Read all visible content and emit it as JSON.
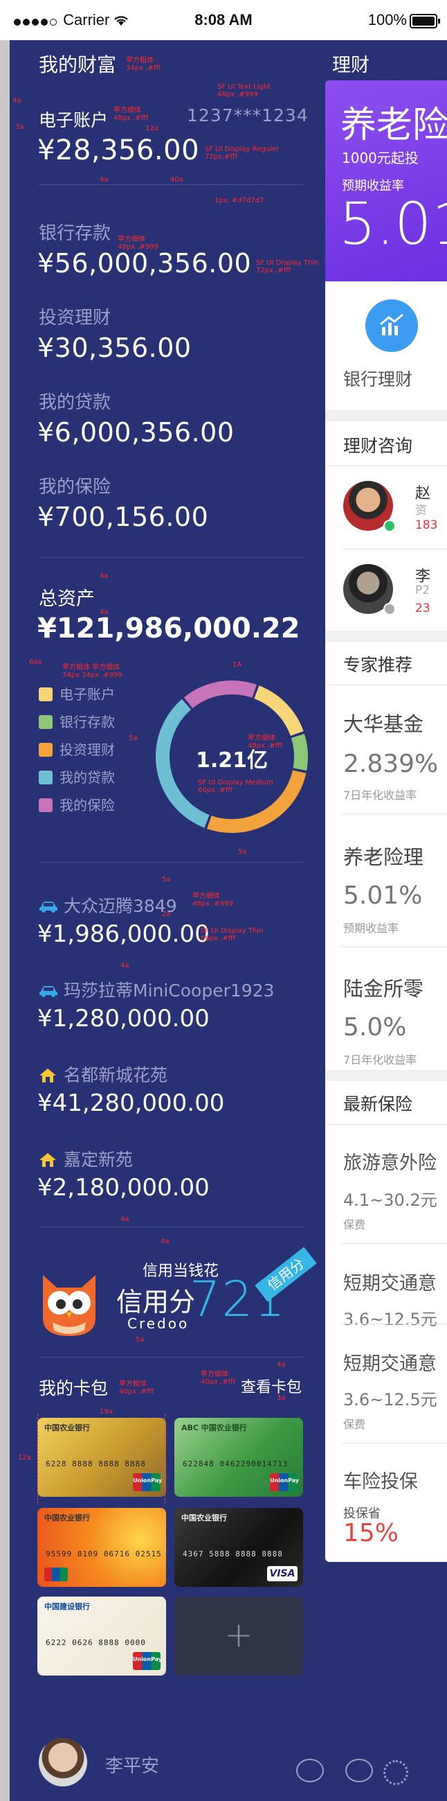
{
  "status_bar": {
    "carrier": "Carrier",
    "time": "8:08 AM",
    "battery": "100%"
  },
  "wealth": {
    "title": "我的财富",
    "e_account_label": "电子账户",
    "e_account_number": "1237***1234",
    "e_account_amount": "¥28,356.00",
    "items": [
      {
        "label": "银行存款",
        "amount": "¥56,000,356.00"
      },
      {
        "label": "投资理财",
        "amount": "¥30,356.00"
      },
      {
        "label": "我的贷款",
        "amount": "¥6,000,356.00"
      },
      {
        "label": "我的保险",
        "amount": "¥700,156.00"
      }
    ],
    "total_label": "总资产",
    "total_amount": "¥121,986,000.22"
  },
  "chart_data": {
    "type": "pie",
    "center_label": "1.21亿",
    "categories": [
      "电子账户",
      "银行存款",
      "投资理财",
      "我的贷款",
      "我的保险"
    ],
    "values": [
      12,
      7,
      23,
      28,
      14
    ],
    "colors": [
      "#f6d678",
      "#8cc677",
      "#f2a33c",
      "#6fbfd2",
      "#c774b8"
    ]
  },
  "assets": [
    {
      "icon": "car-icon",
      "label": "大众迈腾3849",
      "amount": "¥1,986,000.00"
    },
    {
      "icon": "car-icon",
      "label": "玛莎拉蒂MiniCooper1923",
      "amount": "¥1,280,000.00"
    },
    {
      "icon": "house-icon",
      "label": "名都新城花苑",
      "amount": "¥41,280,000.00"
    },
    {
      "icon": "house-icon",
      "label": "嘉定新苑",
      "amount": "¥2,180,000.00"
    }
  ],
  "credit": {
    "slogan": "信用当钱花",
    "label": "信用分",
    "brand": "Credoo",
    "score": "721",
    "ribbon": "信用分"
  },
  "cards": {
    "title": "我的卡包",
    "view_link": "查看卡包",
    "list": [
      {
        "bank": "中国农业银行",
        "number": "6228 8888 8888 8888",
        "style": "gold"
      },
      {
        "bank": "ABC 中国农业银行",
        "number": "622848 0462290014713",
        "style": "green"
      },
      {
        "bank": "中国农业银行",
        "number": "95599 8109 06716 02515",
        "style": "orange"
      },
      {
        "bank": "中国农业银行",
        "number": "4367 5888 8888 8888",
        "style": "black"
      },
      {
        "bank": "中国建设银行",
        "number": "6222 0626 8888 0000",
        "style": "white"
      }
    ],
    "add_symbol": "+"
  },
  "user": {
    "name": "李平安"
  },
  "annotations": {
    "a48": "48a",
    "a4": "4a",
    "a3": "3a",
    "a2": "2a",
    "a12": "12a",
    "a40": "40a",
    "a6": "6px",
    "a1": "1A",
    "a5": "5a",
    "a19": "19a",
    "title_font": "苹方粗体\n34px ,#fff",
    "sf_light": "SF UI Text Light\n48px ,#999",
    "label_font": "苹方细体\n48px ,#fff",
    "sf_regular": "SF UI Display Reguler\n72px,#fff",
    "divider_spec": "1px, #d7d7d7",
    "bank_font": "苹方细体\n48px ,#999",
    "sf_thin": "SF UI Display Thin\n72px ,#fff",
    "legend_font": "苹方粗体  苹方细体\n34px  34px ,#999",
    "center_font": "SF UI Display Medium\n60px ,#fff",
    "center_label_font": "苹方细体\n48px ,#fff",
    "car_font": "苹方细体\n48px ,#999",
    "car_amount_font": "SF UI Display Thin\n66px ,#fff",
    "card_title_font": "苹方粗体\n40px ,#fff",
    "card_link_font": "苹方细体\n40px ,#fff"
  },
  "right_panel": {
    "header": "理财",
    "promo": {
      "title": "养老险",
      "subtitle": "1000元起投",
      "rate_label": "预期收益率",
      "rate": "5.01"
    },
    "bank_wealth_label": "银行理财",
    "consult_title": "理财咨询",
    "consultants": [
      {
        "name": "赵",
        "sub": "资",
        "num": "183"
      },
      {
        "name": "李",
        "sub": "P2",
        "num": "23"
      }
    ],
    "expert_title": "专家推荐",
    "funds": [
      {
        "name": "大华基金",
        "rate": "2.839%",
        "desc": "7日年化收益率"
      },
      {
        "name": "养老险理",
        "rate": "5.01%",
        "desc": "预期收益率"
      },
      {
        "name": "陆金所零",
        "rate": "5.0%",
        "desc": "7日年化收益率"
      }
    ],
    "insurance_title": "最新保险",
    "insurances": [
      {
        "name": "旅游意外险",
        "range": "4.1~30.2元",
        "desc": "保费"
      },
      {
        "name": "短期交通意",
        "range": "3.6~12.5元",
        "desc": ""
      },
      {
        "name": "短期交通意",
        "range": "3.6~12.5元",
        "desc": "保费"
      }
    ],
    "car_ins": {
      "name": "车险投保",
      "sub": "投保省",
      "rate": "15%"
    }
  }
}
